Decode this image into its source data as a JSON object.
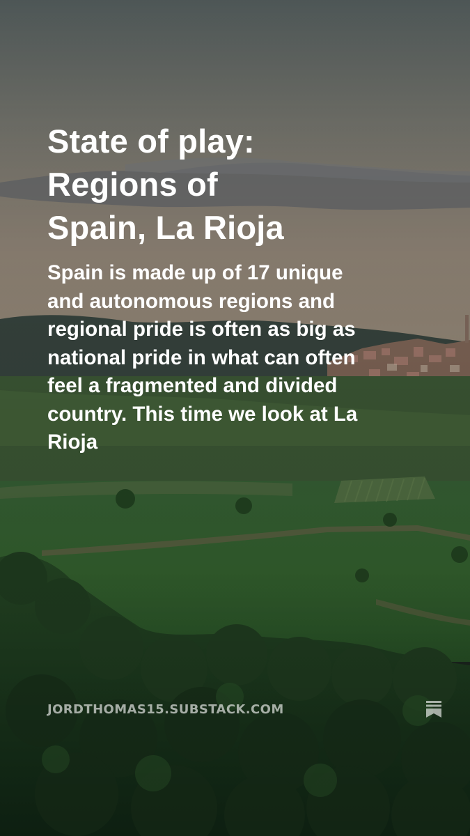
{
  "post": {
    "title": "State of play: Regions of Spain, La Rioja",
    "subtitle": "Spain is made up of 17 unique and autonomous regions and regional pride is often as big as national pride in what can often feel a fragmented and divided country. This time we look at La Rioja"
  },
  "footer": {
    "domain": "JORDTHOMAS15.SUBSTACK.COM",
    "icon": "substack-bookmark-icon"
  },
  "colors": {
    "text": "#ffffff",
    "domain_text": "#c3c9c3",
    "sky_top": "#5c6565",
    "sky_horizon": "#9a9084",
    "field_green": "#3a6a34",
    "forest_dark": "#1c3a1e"
  }
}
